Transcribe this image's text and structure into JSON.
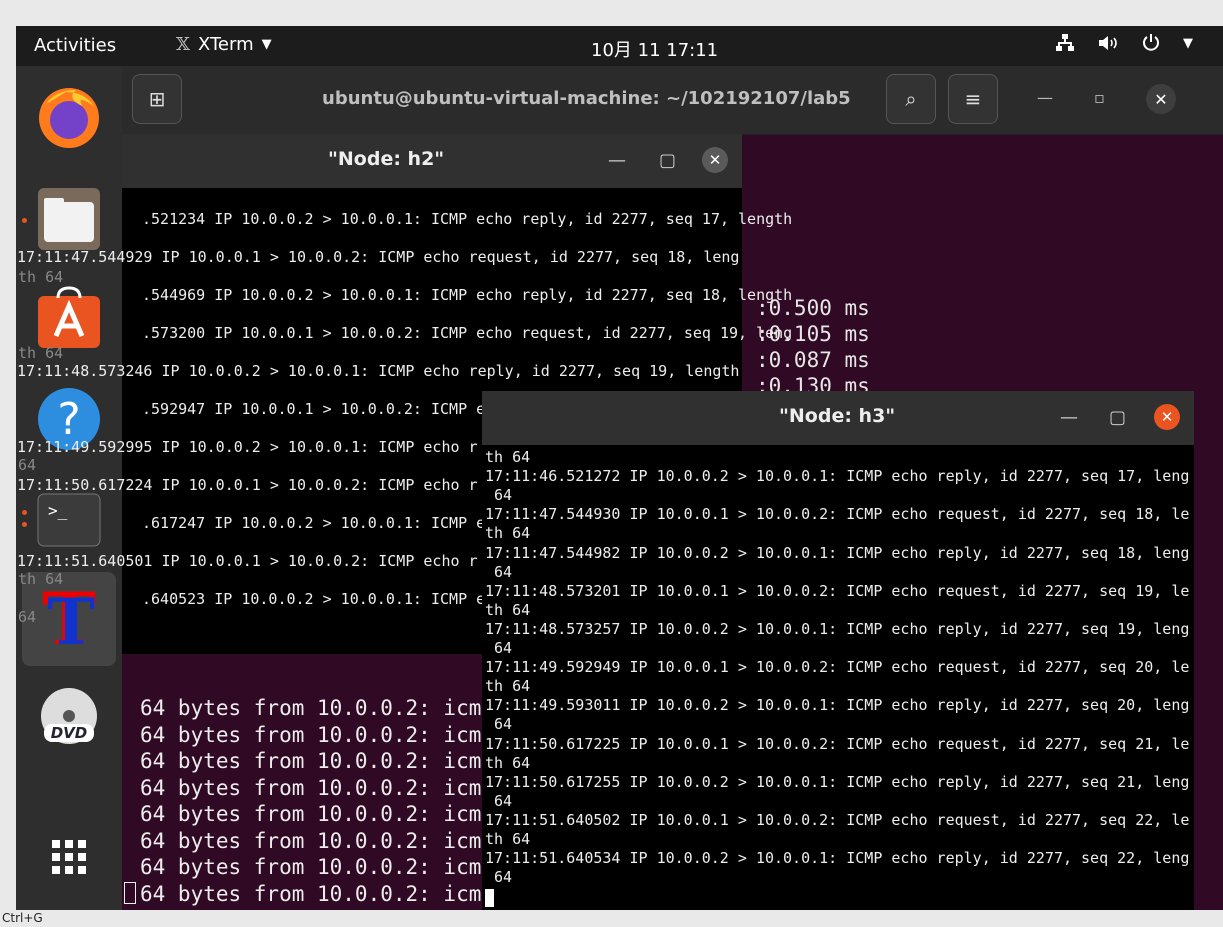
{
  "topbar": {
    "activities": "Activities",
    "app_name": "XTerm",
    "clock": "10月 11  17:11",
    "app_icon": "xterm-icon"
  },
  "dock": {
    "items": [
      "firefox-icon",
      "files-icon",
      "app-center-icon",
      "help-icon",
      "terminal-icon",
      "xterm-icon",
      "dvd-icon",
      "show-apps-icon"
    ]
  },
  "bgterm": {
    "title": "ubuntu@ubuntu-virtual-machine: ~/102192107/lab5",
    "rtt_lines": [
      ":0.500 ms",
      ":0.105 ms",
      ":0.087 ms",
      ":0.130 ms"
    ],
    "ping_lines": [
      "64 bytes from 10.0.0.2: icm",
      "64 bytes from 10.0.0.2: icm",
      "64 bytes from 10.0.0.2: icm",
      "64 bytes from 10.0.0.2: icm",
      "64 bytes from 10.0.0.2: icm",
      "64 bytes from 10.0.0.2: icm",
      "64 bytes from 10.0.0.2: icm",
      "64 bytes from 10.0.0.2: icm",
      "64 bytes from 10.0.0.2: icm"
    ]
  },
  "h2": {
    "title": "\"Node: h2\"",
    "lines": [
      ".521234 IP 10.0.0.2 > 10.0.0.1: ICMP echo reply, id 2277, seq 17, length",
      "17:11:47.544929 IP 10.0.0.1 > 10.0.0.2: ICMP echo request, id 2277, seq 18, leng",
      "th 64",
      ".544969 IP 10.0.0.2 > 10.0.0.1: ICMP echo reply, id 2277, seq 18, length",
      ".573200 IP 10.0.0.1 > 10.0.0.2: ICMP echo request, id 2277, seq 19, leng",
      "th 64",
      "17:11:48.573246 IP 10.0.0.2 > 10.0.0.1: ICMP echo reply, id 2277, seq 19, length",
      ".592947 IP 10.0.0.1 > 10.0.0.2: ICMP echo r",
      "17:11:49.592995 IP 10.0.0.2 > 10.0.0.1: ICMP echo r",
      "64",
      "17:11:50.617224 IP 10.0.0.1 > 10.0.0.2: ICMP echo r",
      ".617247 IP 10.0.0.2 > 10.0.0.1: ICMP echo r",
      "17:11:51.640501 IP 10.0.0.1 > 10.0.0.2: ICMP echo r",
      "th 64",
      ".640523 IP 10.0.0.2 > 10.0.0.1: ICMP echo r",
      "64"
    ]
  },
  "h3": {
    "title": "\"Node: h3\"",
    "lines": [
      "th 64",
      "17:11:46.521272 IP 10.0.0.2 > 10.0.0.1: ICMP echo reply, id 2277, seq 17, length",
      " 64",
      "17:11:47.544930 IP 10.0.0.1 > 10.0.0.2: ICMP echo request, id 2277, seq 18, leng",
      "th 64",
      "17:11:47.544982 IP 10.0.0.2 > 10.0.0.1: ICMP echo reply, id 2277, seq 18, length",
      " 64",
      "17:11:48.573201 IP 10.0.0.1 > 10.0.0.2: ICMP echo request, id 2277, seq 19, leng",
      "th 64",
      "17:11:48.573257 IP 10.0.0.2 > 10.0.0.1: ICMP echo reply, id 2277, seq 19, length",
      " 64",
      "17:11:49.592949 IP 10.0.0.1 > 10.0.0.2: ICMP echo request, id 2277, seq 20, leng",
      "th 64",
      "17:11:49.593011 IP 10.0.0.2 > 10.0.0.1: ICMP echo reply, id 2277, seq 20, length",
      " 64",
      "17:11:50.617225 IP 10.0.0.1 > 10.0.0.2: ICMP echo request, id 2277, seq 21, leng",
      "th 64",
      "17:11:50.617255 IP 10.0.0.2 > 10.0.0.1: ICMP echo reply, id 2277, seq 21, length",
      " 64",
      "17:11:51.640502 IP 10.0.0.1 > 10.0.0.2: ICMP echo request, id 2277, seq 22, leng",
      "th 64",
      "17:11:51.640534 IP 10.0.0.2 > 10.0.0.1: ICMP echo reply, id 2277, seq 22, length",
      " 64"
    ]
  },
  "bottom_hint": "Ctrl+G",
  "colors": {
    "ubuntu_orange": "#e95420",
    "terminal_bg": "#300a24"
  }
}
